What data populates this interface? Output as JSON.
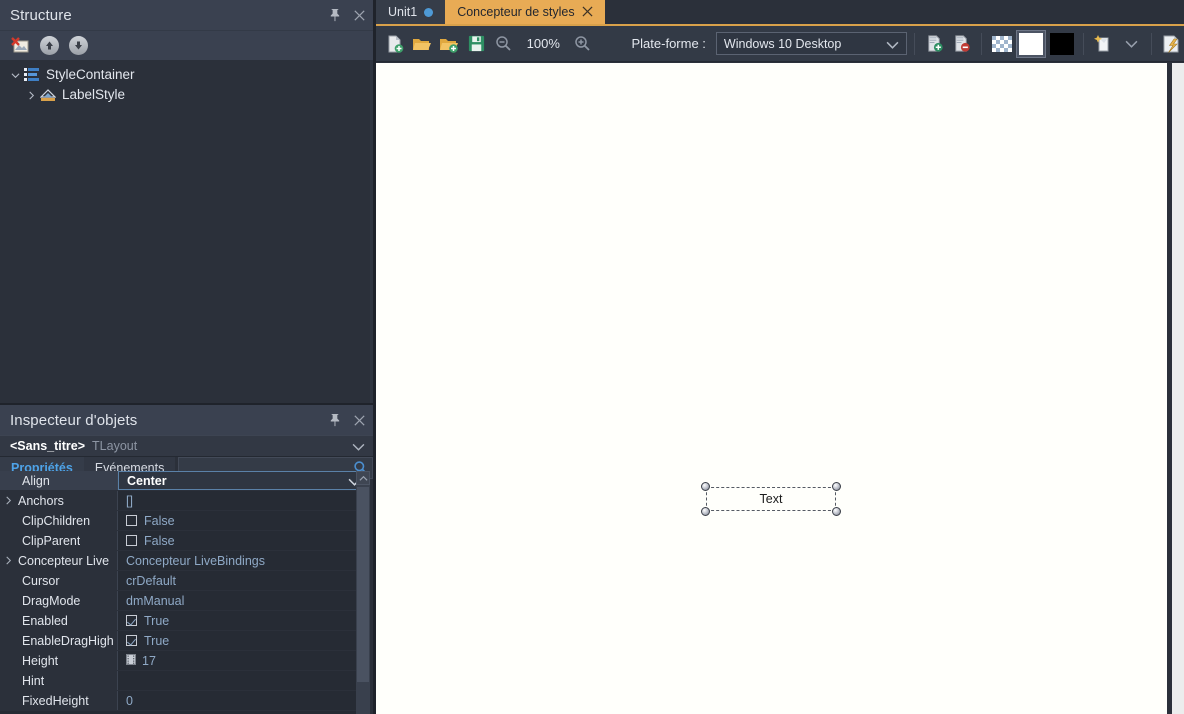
{
  "structure": {
    "title": "Structure",
    "pin_icon": "pin-icon",
    "close_icon": "close-icon",
    "toolbar": [
      {
        "name": "delete-item-button",
        "icon": "delete-image-icon"
      },
      {
        "name": "move-up-button",
        "icon": "arrow-up-icon"
      },
      {
        "name": "move-down-button",
        "icon": "arrow-down-icon"
      }
    ],
    "tree": [
      {
        "label": "StyleContainer",
        "expanded": true,
        "indent": 0,
        "icon": "style-container-icon"
      },
      {
        "label": "LabelStyle",
        "expanded": false,
        "indent": 1,
        "icon": "label-style-icon"
      }
    ]
  },
  "inspector": {
    "title": "Inspecteur d'objets",
    "pin_icon": "pin-icon",
    "close_icon": "close-icon",
    "object_name": "<Sans_titre>",
    "object_type": "TLayout",
    "tabs": [
      {
        "label": "Propriétés",
        "active": true
      },
      {
        "label": "Evénements",
        "active": false
      }
    ],
    "search_value": "",
    "search_placeholder": "",
    "search_icon": "search-icon",
    "properties": [
      {
        "name": "Align",
        "value": "Center",
        "type": "dropdown",
        "selected": true,
        "expandable": false
      },
      {
        "name": "Anchors",
        "value": "[]",
        "type": "text",
        "selected": false,
        "expandable": true
      },
      {
        "name": "ClipChildren",
        "value": "False",
        "type": "checkbox",
        "checked": false,
        "selected": false,
        "expandable": false
      },
      {
        "name": "ClipParent",
        "value": "False",
        "type": "checkbox",
        "checked": false,
        "selected": false,
        "expandable": false
      },
      {
        "name": "Concepteur Live",
        "value": "Concepteur LiveBindings",
        "type": "text",
        "selected": false,
        "expandable": true
      },
      {
        "name": "Cursor",
        "value": "crDefault",
        "type": "text",
        "selected": false,
        "expandable": false
      },
      {
        "name": "DragMode",
        "value": "dmManual",
        "type": "text",
        "selected": false,
        "expandable": false
      },
      {
        "name": "Enabled",
        "value": "True",
        "type": "checkbox",
        "checked": true,
        "selected": false,
        "expandable": false
      },
      {
        "name": "EnableDragHigh",
        "value": "True",
        "type": "checkbox",
        "checked": true,
        "selected": false,
        "expandable": false
      },
      {
        "name": "Height",
        "value": "17",
        "type": "grid-icon",
        "selected": false,
        "expandable": false
      },
      {
        "name": "Hint",
        "value": "",
        "type": "text",
        "selected": false,
        "expandable": false
      },
      {
        "name": "FixedHeight",
        "value": "0",
        "type": "text",
        "selected": false,
        "expandable": false
      }
    ]
  },
  "designer": {
    "tabs": [
      {
        "label": "Unit1",
        "active": false,
        "has_dot": true,
        "closable": false
      },
      {
        "label": "Concepteur de styles",
        "active": true,
        "has_dot": false,
        "closable": true
      }
    ],
    "toolbar": {
      "buttons": [
        {
          "name": "new-style-file-button",
          "icon": "new-file-icon"
        },
        {
          "name": "open-style-button",
          "icon": "open-folder-icon"
        },
        {
          "name": "add-style-folder-button",
          "icon": "add-folder-icon"
        },
        {
          "name": "save-style-button",
          "icon": "save-icon"
        },
        {
          "name": "zoom-out-button",
          "icon": "zoom-out-icon"
        },
        {
          "name": "zoom-in-button",
          "icon": "zoom-in-icon"
        }
      ],
      "zoom_level": "100%",
      "platform_label": "Plate-forme :",
      "platform_value": "Windows 10 Desktop",
      "right_buttons": [
        {
          "name": "add-style-button",
          "icon": "add-style-icon"
        },
        {
          "name": "remove-style-button",
          "icon": "remove-style-icon"
        },
        {
          "name": "transparent-background-button",
          "icon": "checkerboard-icon"
        },
        {
          "name": "white-background-button",
          "icon": "white-swatch-icon"
        },
        {
          "name": "black-background-button",
          "icon": "black-swatch-icon"
        },
        {
          "name": "new-style-resource-button",
          "icon": "new-style-resource-icon"
        },
        {
          "name": "new-style-dropdown-button",
          "icon": "chevron-down-icon"
        },
        {
          "name": "apply-style-button",
          "icon": "apply-style-icon"
        }
      ]
    },
    "canvas": {
      "selected_control_text": "Text"
    }
  },
  "colors": {
    "accent_tab": "#e8ab55",
    "accent_link": "#4ea3e8",
    "panel_bg": "#2b303a",
    "titlebar_bg": "#3a4150",
    "canvas_bg": "#fffffb",
    "property_value": "#8fa9c6"
  }
}
